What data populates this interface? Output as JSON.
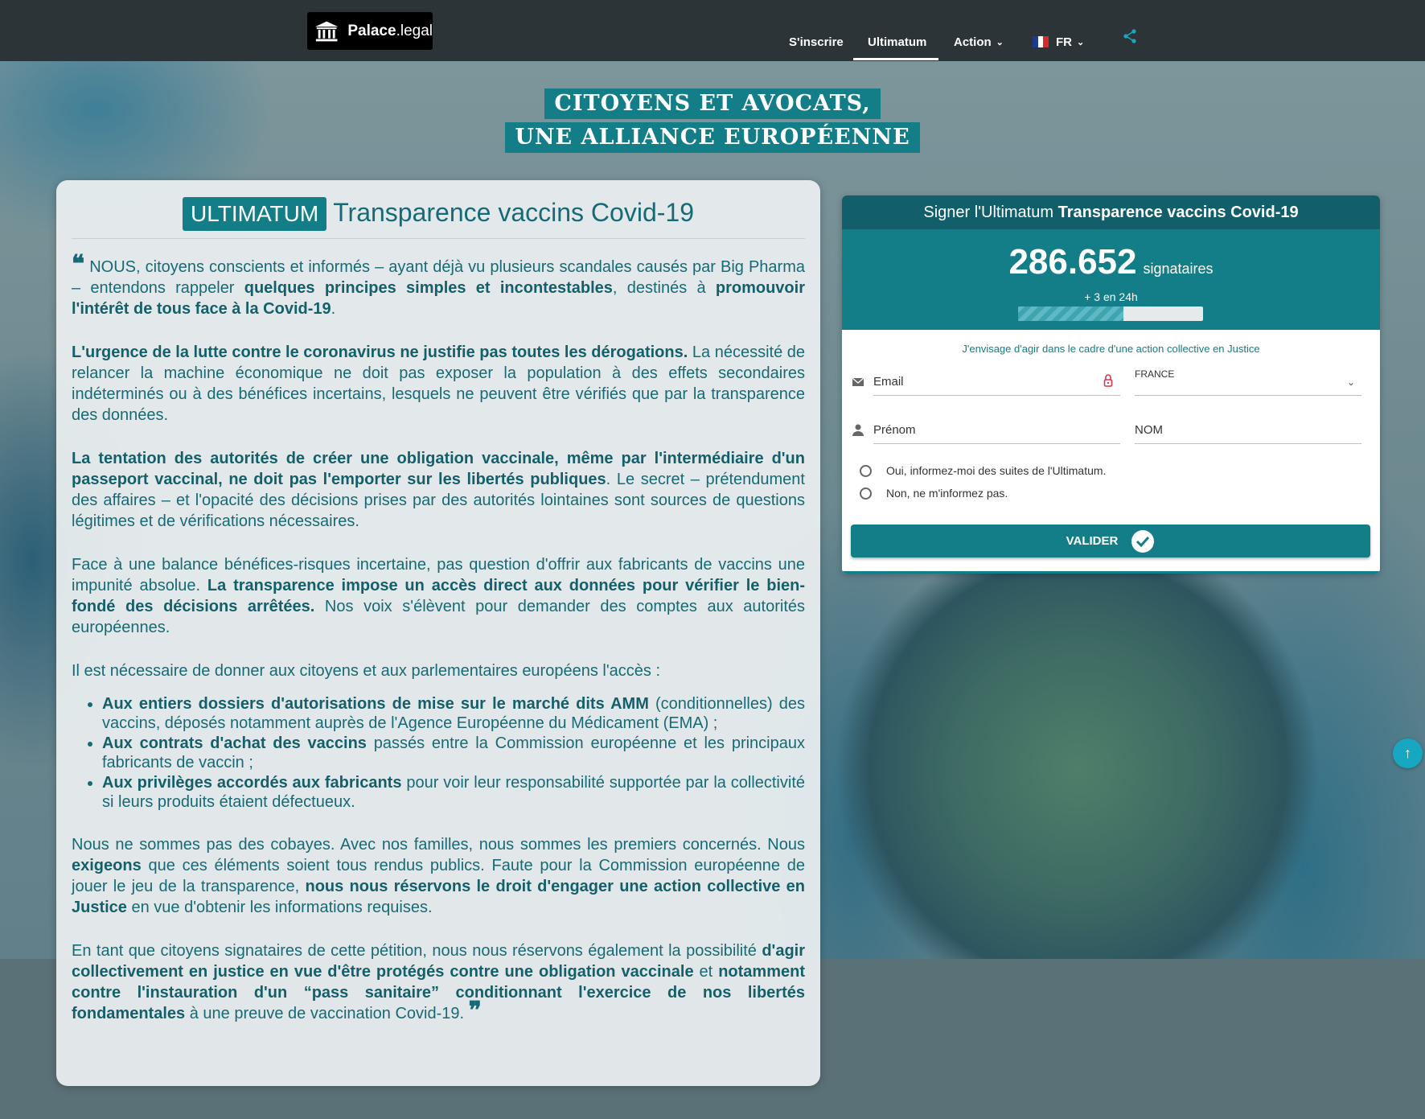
{
  "header": {
    "brand_bold": "Palace",
    "brand_light": ".legal",
    "nav": {
      "signup": "S'inscrire",
      "ultimatum": "Ultimatum",
      "action": "Action",
      "lang": "FR"
    }
  },
  "banner": {
    "line1": "CITOYENS ET AVOCATS,",
    "line2": "UNE ALLIANCE EUROPÉENNE"
  },
  "article": {
    "badge": "ULTIMATUM",
    "title": "Transparence vaccins Covid-19",
    "p1": {
      "t1": " NOUS, citoyens conscients et informés – ayant déjà vu plusieurs scandales causés par Big Pharma – entendons rappeler ",
      "b1": "quelques principes simples et incontestables",
      "t2": ", destinés à ",
      "b2": "promouvoir l'intérêt de tous face à la Covid-19",
      "t3": "."
    },
    "p2": {
      "b1": "L'urgence de la lutte contre le coronavirus ne justifie pas toutes les dérogations.",
      "t1": " La nécessité de relancer la machine économique ne doit pas exposer la population à des effets secondaires indéterminés ou à des bénéfices incertains, lesquels ne peuvent être vérifiés que par la transparence des données."
    },
    "p3": {
      "b1": "La tentation des autorités de créer une obligation vaccinale, même par l'intermédiaire d'un passeport vaccinal, ne doit pas l'emporter sur les libertés publiques",
      "t1": ". Le secret – prétendument des affaires – et l'opacité des décisions prises par des autorités lointaines sont sources de questions légitimes et de vérifications nécessaires."
    },
    "p4": {
      "t1": "Face à une balance bénéfices-risques incertaine, pas question d'offrir aux fabricants de vaccins une impunité absolue. ",
      "b1": "La transparence impose un accès direct aux données pour vérifier le bien-fondé des décisions arrêtées.",
      "t2": " Nos voix s'élèvent pour demander des comptes aux autorités européennes."
    },
    "p5": "Il est nécessaire de donner aux citoyens et aux parlementaires européens l'accès :",
    "list": [
      {
        "b": "Aux entiers dossiers d'autorisations de mise sur le marché dits AMM",
        "t": " (conditionnelles) des vaccins, déposés notamment auprès de l'Agence Européenne du Médicament (EMA) ;"
      },
      {
        "b": "Aux contrats d'achat des vaccins",
        "t": " passés entre la Commission européenne et les principaux fabricants de vaccin ;"
      },
      {
        "b": "Aux privilèges accordés aux fabricants",
        "t": " pour voir leur responsabilité supportée par la collectivité si leurs produits étaient défectueux."
      }
    ],
    "p6": {
      "t1": "Nous ne sommes pas des cobayes. Avec nos familles, nous sommes les premiers concernés. Nous ",
      "b1": "exigeons",
      "t2": " que ces éléments soient tous rendus publics. Faute pour la Commission européenne de jouer le jeu de la transparence, ",
      "b2": "nous nous réservons le droit d'engager une action collective en Justice",
      "t3": " en vue d'obtenir les informations requises."
    },
    "p7": {
      "t1": "En tant que citoyens signataires de cette pétition, nous nous réservons également la possibilité ",
      "b1": "d'agir collectivement en justice en vue d'être protégés contre une obligation vaccinale",
      "t2": " et ",
      "b2": "notamment contre l'instauration d'un “pass sanitaire” conditionnant l'exercice de nos libertés fondamentales",
      "t3": " à une preuve de vaccination Covid-19. "
    },
    "quote_open": "❝",
    "quote_close": "❞"
  },
  "sign": {
    "head_prefix": "Signer l'Ultimatum ",
    "head_bold": "Transparence vaccins Covid-19",
    "count": "286.652",
    "count_label": "signataires",
    "last24": "+ 3 en 24h",
    "progress": 0.57,
    "action_note": "J'envisage d'agir dans le cadre d'une action collective en Justice",
    "email_placeholder": "Email",
    "country_label": "FRANCE",
    "firstname_placeholder": "Prénom",
    "lastname_placeholder": "NOM",
    "radio_yes": "Oui, informez-moi des suites de l'Ultimatum.",
    "radio_no": "Non, ne m'informez pas.",
    "submit": "VALIDER"
  },
  "colors": {
    "teal": "#137d88",
    "teal_dark": "#125e6a",
    "header_bg": "#2c3437",
    "text": "#176a75"
  }
}
